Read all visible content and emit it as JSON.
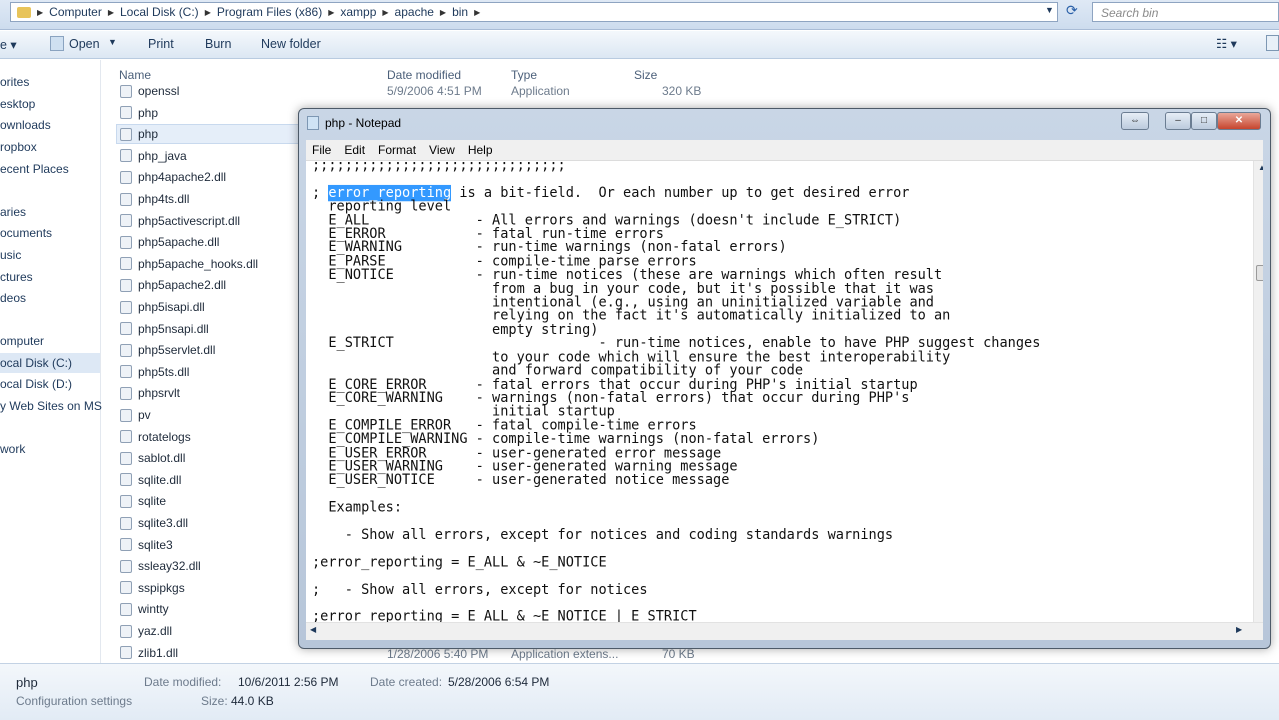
{
  "address": {
    "crumbs": [
      "Computer",
      "Local Disk (C:)",
      "Program Files (x86)",
      "xampp",
      "apache",
      "bin"
    ],
    "search_placeholder": "Search bin"
  },
  "toolbar": {
    "organize": "e ▾",
    "open": "Open",
    "print": "Print",
    "burn": "Burn",
    "new_folder": "New folder"
  },
  "nav": [
    "orites",
    "esktop",
    "ownloads",
    "ropbox",
    "ecent Places",
    "aries",
    "ocuments",
    "usic",
    "ctures",
    "deos",
    "omputer",
    "ocal Disk (C:)",
    "ocal Disk (D:)",
    "y Web Sites on MS",
    "work"
  ],
  "columns": {
    "name": "Name",
    "date": "Date modified",
    "type": "Type",
    "size": "Size"
  },
  "files": [
    "openssl",
    "php",
    "php",
    "php_java",
    "php4apache2.dll",
    "php4ts.dll",
    "php5activescript.dll",
    "php5apache.dll",
    "php5apache_hooks.dll",
    "php5apache2.dll",
    "php5isapi.dll",
    "php5nsapi.dll",
    "php5servlet.dll",
    "php5ts.dll",
    "phpsrvlt",
    "pv",
    "rotatelogs",
    "sablot.dll",
    "sqlite.dll",
    "sqlite",
    "sqlite3.dll",
    "sqlite3",
    "ssleay32.dll",
    "sspipkgs",
    "wintty",
    "yaz.dll",
    "zlib1.dll"
  ],
  "first_row": {
    "date": "5/9/2006 4:51 PM",
    "type": "Application",
    "size": "320 KB"
  },
  "last_row": {
    "date": "1/28/2006 5:40 PM",
    "type": "Application extens...",
    "size": "70 KB"
  },
  "details": {
    "name": "php",
    "kind": "Configuration settings",
    "modified_label": "Date modified:",
    "modified": "10/6/2011 2:56 PM",
    "created_label": "Date created:",
    "created": "5/28/2006 6:54 PM",
    "size_label": "Size:",
    "size": "44.0 KB"
  },
  "notepad": {
    "title": "php - Notepad",
    "menu": [
      "File",
      "Edit",
      "Format",
      "View",
      "Help"
    ],
    "highlight": "error_reporting",
    "line1": ";;;;;;;;;;;;;;;;;;;;;;;;;;;;;;;",
    "line2_pre": "; ",
    "line2_post": " is a bit-field.  Or each number up to get desired error",
    "body": "  reporting level\n  E_ALL             - All errors and warnings (doesn't include E_STRICT)\n  E_ERROR           - fatal run-time errors\n  E_WARNING         - run-time warnings (non-fatal errors)\n  E_PARSE           - compile-time parse errors\n  E_NOTICE          - run-time notices (these are warnings which often result\n                      from a bug in your code, but it's possible that it was\n                      intentional (e.g., using an uninitialized variable and\n                      relying on the fact it's automatically initialized to an\n                      empty string)\n  E_STRICT                         - run-time notices, enable to have PHP suggest changes\n                      to your code which will ensure the best interoperability\n                      and forward compatibility of your code\n  E_CORE_ERROR      - fatal errors that occur during PHP's initial startup\n  E_CORE_WARNING    - warnings (non-fatal errors) that occur during PHP's\n                      initial startup\n  E_COMPILE_ERROR   - fatal compile-time errors\n  E_COMPILE_WARNING - compile-time warnings (non-fatal errors)\n  E_USER_ERROR      - user-generated error message\n  E_USER_WARNING    - user-generated warning message\n  E_USER_NOTICE     - user-generated notice message\n\n  Examples:\n\n    - Show all errors, except for notices and coding standards warnings\n\n;error_reporting = E_ALL & ~E_NOTICE\n\n;   - Show all errors, except for notices\n\n;error_reporting = E_ALL & ~E_NOTICE | E_STRICT"
  }
}
